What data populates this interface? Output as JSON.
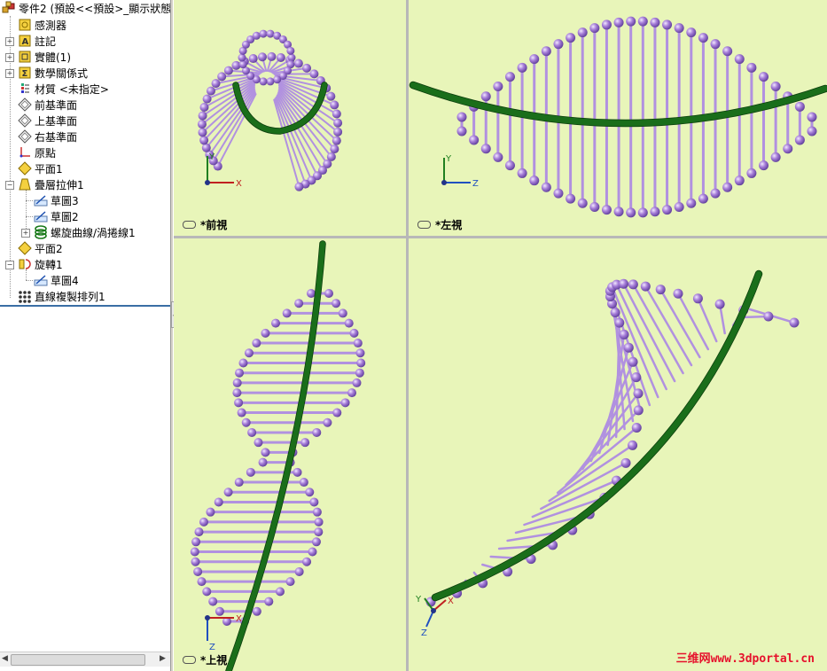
{
  "tree": {
    "root": "零件2 (預設<<預設>_顯示狀態",
    "items": [
      {
        "label": "感測器",
        "icon": "sensor-icon"
      },
      {
        "label": "註記",
        "icon": "annotation-icon"
      },
      {
        "label": "實體(1)",
        "icon": "solid-bodies-icon"
      },
      {
        "label": "數學關係式",
        "icon": "equations-icon"
      },
      {
        "label": "材質 <未指定>",
        "icon": "material-icon"
      },
      {
        "label": "前基準面",
        "icon": "plane-icon"
      },
      {
        "label": "上基準面",
        "icon": "plane-icon"
      },
      {
        "label": "右基準面",
        "icon": "plane-icon"
      },
      {
        "label": "原點",
        "icon": "origin-icon"
      },
      {
        "label": "平面1",
        "icon": "plane-icon"
      },
      {
        "label": "疊層拉伸1",
        "icon": "loft-icon"
      },
      {
        "label": "草圖3",
        "icon": "sketch-icon"
      },
      {
        "label": "草圖2",
        "icon": "sketch-icon"
      },
      {
        "label": "螺旋曲線/渦捲線1",
        "icon": "helix-icon"
      },
      {
        "label": "平面2",
        "icon": "plane-icon"
      },
      {
        "label": "旋轉1",
        "icon": "revolve-icon"
      },
      {
        "label": "草圖4",
        "icon": "sketch-icon"
      },
      {
        "label": "直線複製排列1",
        "icon": "linear-pattern-icon"
      }
    ]
  },
  "views": {
    "front": "*前視",
    "left": "*左視",
    "top": "*上視"
  },
  "axes": {
    "x": "X",
    "y": "Y",
    "z": "Z"
  },
  "watermark": "三维网www.3dportal.cn",
  "colors": {
    "viewport_bg": "#e8f5b9",
    "rod": "#b191e0",
    "ball": "#a77fd9",
    "helix": "#1a6e1a",
    "watermark": "#e6112c"
  }
}
